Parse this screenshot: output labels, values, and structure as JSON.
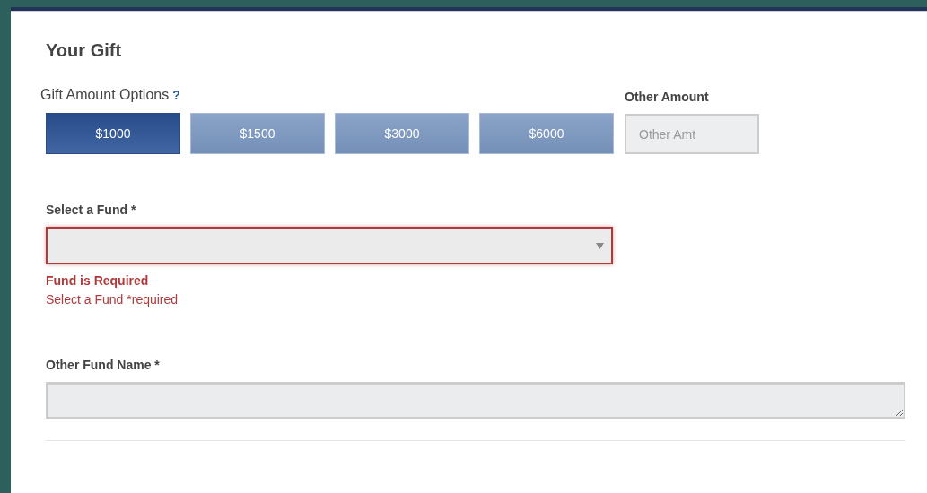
{
  "heading": "Your Gift",
  "amount_options": {
    "label": "Gift Amount Options",
    "help": "?",
    "options": [
      {
        "label": "$1000",
        "selected": true
      },
      {
        "label": "$1500",
        "selected": false
      },
      {
        "label": "$3000",
        "selected": false
      },
      {
        "label": "$6000",
        "selected": false
      }
    ]
  },
  "other_amount": {
    "label": "Other Amount",
    "placeholder": "Other Amt"
  },
  "fund": {
    "label": "Select a Fund *",
    "invalid": true,
    "error_title": "Fund is Required",
    "error_text": "Select a Fund *required"
  },
  "other_fund_name": {
    "label": "Other Fund Name *"
  }
}
